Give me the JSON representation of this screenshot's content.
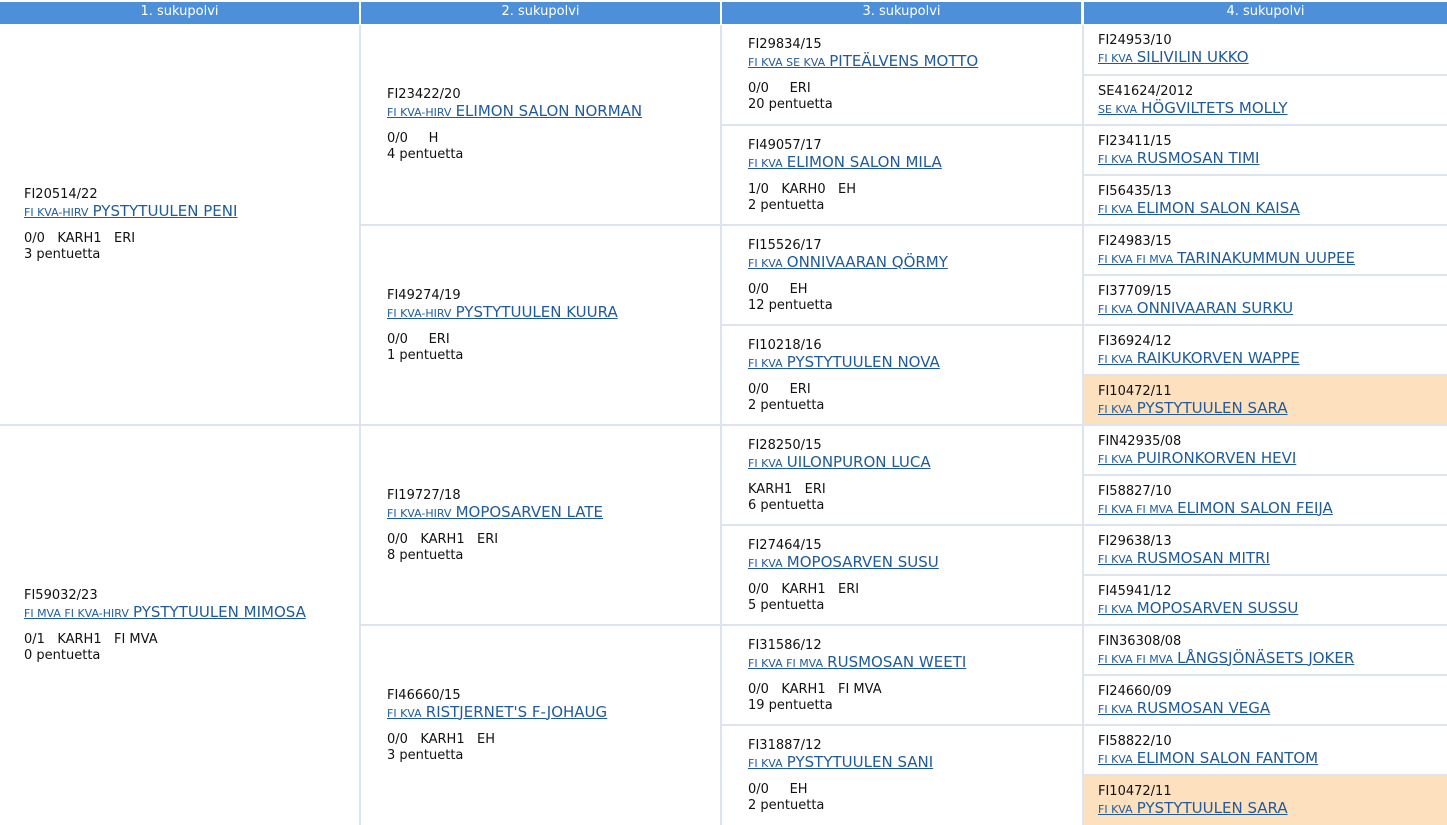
{
  "headers": [
    "1. sukupolvi",
    "2. sukupolvi",
    "3. sukupolvi",
    "4. sukupolvi"
  ],
  "gen1": [
    {
      "reg": "FI20514/22",
      "titles": "FI KVA-HIRV",
      "name": "PYSTYTUULEN PENI",
      "stats": "0/0   KARH1   ERI",
      "litters": "3 pentuetta"
    },
    {
      "reg": "FI59032/23",
      "titles": "FI MVA FI KVA-HIRV",
      "name": "PYSTYTUULEN MIMOSA",
      "stats": "0/1   KARH1   FI MVA",
      "litters": "0 pentuetta"
    }
  ],
  "gen2": [
    {
      "reg": "FI23422/20",
      "titles": "FI KVA-HIRV",
      "name": "ELIMON SALON NORMAN",
      "stats": "0/0     H",
      "litters": "4 pentuetta"
    },
    {
      "reg": "FI49274/19",
      "titles": "FI KVA-HIRV",
      "name": "PYSTYTUULEN KUURA",
      "stats": "0/0     ERI",
      "litters": "1 pentuetta"
    },
    {
      "reg": "FI19727/18",
      "titles": "FI KVA-HIRV",
      "name": "MOPOSARVEN LATE",
      "stats": "0/0   KARH1   ERI",
      "litters": "8 pentuetta"
    },
    {
      "reg": "FI46660/15",
      "titles": "FI KVA",
      "name": "RISTJERNET'S F-JOHAUG",
      "stats": "0/0   KARH1   EH",
      "litters": "3 pentuetta"
    }
  ],
  "gen3": [
    {
      "reg": "FI29834/15",
      "titles": "FI KVA SE KVA",
      "name": "PITEÄLVENS MOTTO",
      "stats": "0/0     ERI",
      "litters": "20 pentuetta"
    },
    {
      "reg": "FI49057/17",
      "titles": "FI KVA",
      "name": "ELIMON SALON MILA",
      "stats": "1/0   KARH0   EH",
      "litters": "2 pentuetta"
    },
    {
      "reg": "FI15526/17",
      "titles": "FI KVA",
      "name": "ONNIVAARAN QÖRMY",
      "stats": "0/0     EH",
      "litters": "12 pentuetta"
    },
    {
      "reg": "FI10218/16",
      "titles": "FI KVA",
      "name": "PYSTYTUULEN NOVA",
      "stats": "0/0     ERI",
      "litters": "2 pentuetta"
    },
    {
      "reg": "FI28250/15",
      "titles": "FI KVA",
      "name": "UILONPURON LUCA",
      "stats": "KARH1   ERI",
      "litters": "6 pentuetta"
    },
    {
      "reg": "FI27464/15",
      "titles": "FI KVA",
      "name": "MOPOSARVEN SUSU",
      "stats": "0/0   KARH1   ERI",
      "litters": "5 pentuetta"
    },
    {
      "reg": "FI31586/12",
      "titles": "FI KVA FI MVA",
      "name": "RUSMOSAN WEETI",
      "stats": "0/0   KARH1   FI MVA",
      "litters": "19 pentuetta"
    },
    {
      "reg": "FI31887/12",
      "titles": "FI KVA",
      "name": "PYSTYTUULEN SANI",
      "stats": "0/0     EH",
      "litters": "2 pentuetta"
    }
  ],
  "gen4": [
    {
      "reg": "FI24953/10",
      "titles": "FI KVA",
      "name": "SILIVILIN UKKO",
      "highlight": false
    },
    {
      "reg": "SE41624/2012",
      "titles": "SE KVA",
      "name": "HÖGVILTETS MOLLY",
      "highlight": false
    },
    {
      "reg": "FI23411/15",
      "titles": "FI KVA",
      "name": "RUSMOSAN TIMI",
      "highlight": false
    },
    {
      "reg": "FI56435/13",
      "titles": "FI KVA",
      "name": "ELIMON SALON KAISA",
      "highlight": false
    },
    {
      "reg": "FI24983/15",
      "titles": "FI KVA FI MVA",
      "name": "TARINAKUMMUN UUPEE",
      "highlight": false
    },
    {
      "reg": "FI37709/15",
      "titles": "FI KVA",
      "name": "ONNIVAARAN SURKU",
      "highlight": false
    },
    {
      "reg": "FI36924/12",
      "titles": "FI KVA",
      "name": "RAIKUKORVEN WAPPE",
      "highlight": false
    },
    {
      "reg": "FI10472/11",
      "titles": "FI KVA",
      "name": "PYSTYTUULEN SARA",
      "highlight": true
    },
    {
      "reg": "FIN42935/08",
      "titles": "FI KVA",
      "name": "PUIRONKORVEN HEVI",
      "highlight": false
    },
    {
      "reg": "FI58827/10",
      "titles": "FI KVA FI MVA",
      "name": "ELIMON SALON FEIJA",
      "highlight": false
    },
    {
      "reg": "FI29638/13",
      "titles": "FI KVA",
      "name": "RUSMOSAN MITRI",
      "highlight": false
    },
    {
      "reg": "FI45941/12",
      "titles": "FI KVA",
      "name": "MOPOSARVEN SUSSU",
      "highlight": false
    },
    {
      "reg": "FIN36308/08",
      "titles": "FI KVA FI MVA",
      "name": "LÅNGSJÖNÄSETS JOKER",
      "highlight": false
    },
    {
      "reg": "FI24660/09",
      "titles": "FI KVA",
      "name": "RUSMOSAN VEGA",
      "highlight": false
    },
    {
      "reg": "FI58822/10",
      "titles": "FI KVA",
      "name": "ELIMON SALON FANTOM",
      "highlight": false
    },
    {
      "reg": "FI10472/11",
      "titles": "FI KVA",
      "name": "PYSTYTUULEN SARA",
      "highlight": true
    }
  ]
}
